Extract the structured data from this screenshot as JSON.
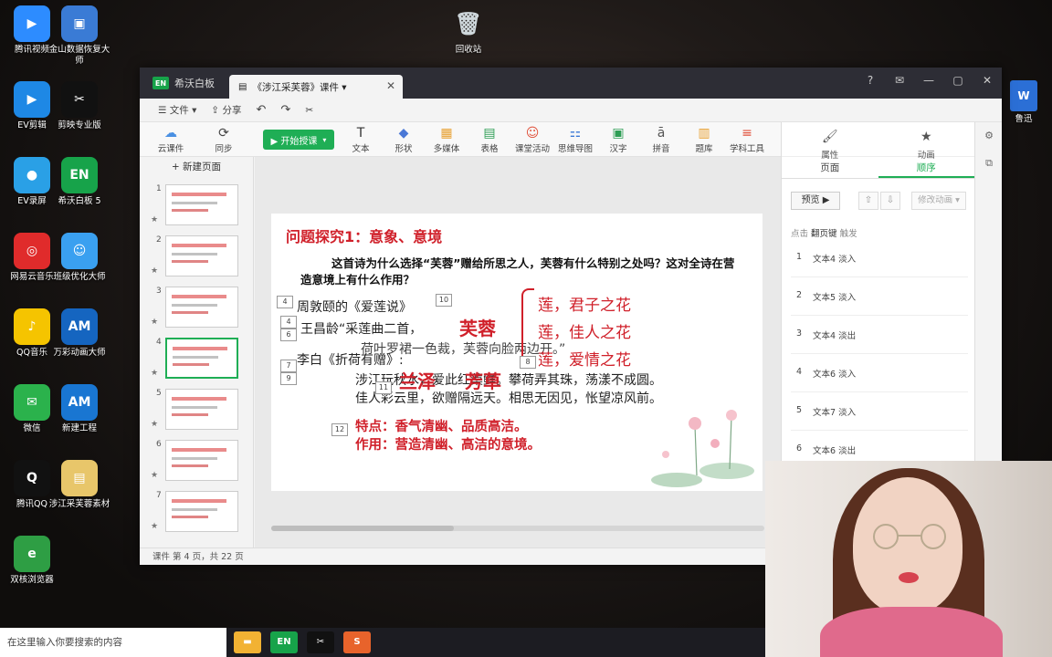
{
  "desktop": {
    "icons_left": [
      {
        "label": "腾讯视频",
        "color": "#2d8cff",
        "glyph": "▶"
      },
      {
        "label": "金山数据恢复大师",
        "color": "#3a7bd5",
        "glyph": "▣"
      },
      {
        "label": "EV剪辑",
        "color": "#1e88e5",
        "glyph": "▶"
      },
      {
        "label": "剪映专业版",
        "color": "#111111",
        "glyph": "✂"
      },
      {
        "label": "EV录屏",
        "color": "#2aa0e6",
        "glyph": "●"
      },
      {
        "label": "希沃白板 5",
        "color": "#17a34a",
        "glyph": "EN"
      },
      {
        "label": "网易云音乐",
        "color": "#e02b2b",
        "glyph": "◎"
      },
      {
        "label": "班级优化大师",
        "color": "#3aa0f0",
        "glyph": "☺"
      },
      {
        "label": "QQ音乐",
        "color": "#f5c400",
        "glyph": "♪"
      },
      {
        "label": "万彩动画大师",
        "color": "#1565c0",
        "glyph": "AM"
      },
      {
        "label": "微信",
        "color": "#2bb24c",
        "glyph": "✉"
      },
      {
        "label": "新建工程",
        "color": "#1976d2",
        "glyph": "AM"
      },
      {
        "label": "腾讯QQ",
        "color": "#111111",
        "glyph": "Q"
      },
      {
        "label": "涉江采芙蓉素材",
        "color": "#e8c66a",
        "glyph": "▤"
      },
      {
        "label": "双核浏览器",
        "color": "#2e9e44",
        "glyph": "e"
      }
    ],
    "recycle_bin": "回收站",
    "right_icon": "鲁迅"
  },
  "app": {
    "app_name": "希沃白板",
    "logo": "EN",
    "doc_tab": "《涉江采芙蓉》课件 ▾",
    "menu": {
      "file": "☰ 文件 ▾",
      "share": "⇪ 分享",
      "undo": "↶",
      "redo": "↷",
      "cut": "✂"
    },
    "toolbar": {
      "cloud": "云课件",
      "sync": "同步",
      "start": "▶ 开始授课",
      "items": [
        "文本",
        "形状",
        "多媒体",
        "表格",
        "课堂活动",
        "思维导图",
        "汉字",
        "拼音",
        "题库",
        "学科工具"
      ]
    },
    "new_page": "+ 新建页面",
    "thumb_numbers": [
      "1",
      "2",
      "3",
      "4",
      "5",
      "6",
      "7"
    ],
    "status": "课件 第 4 页，共 22 页"
  },
  "slide": {
    "title": "问题探究1：意象、意境",
    "question": "这首诗为什么选择“芙蓉”赠给所思之人，芙蓉有什么特别之处吗？这对全诗在营造意境上有什么作用？",
    "line1": "周敦颐的《爱莲说》",
    "line2": "王昌龄“采莲曲二首，",
    "line2b": "荷叶罗裙一色裁，芙蓉向脸两边开。”",
    "line3": "李白《折荷有赠》:",
    "line4": "涉江玩秋水，爱此红蕖鲜。攀荷弄其珠，荡漾不成圆。",
    "line5": "佳人彩云里，欲赠隔远天。相思无因见，怅望凉风前。",
    "furong": "芙蓉",
    "lan_ze": "兰泽",
    "fang_cao": "芳草",
    "lotus_lines": [
      "莲，君子之花",
      "莲，佳人之花",
      "莲，爱情之花"
    ],
    "feature": "特点：香气清幽、品质高洁。",
    "effect": "作用：营造清幽、高洁的意境。",
    "tags": [
      "4",
      "10",
      "4",
      "6",
      "7",
      "9",
      "11",
      "12",
      "8"
    ]
  },
  "right_panel": {
    "attr": "属性",
    "anim": "动画",
    "tab_page": "页面",
    "tab_order": "顺序",
    "preview": "预览 ▶",
    "up": "⇧",
    "down": "⇩",
    "modify": "修改动画 ▾",
    "hint_prefix": "点击",
    "hint_key": "翻页键",
    "hint_suffix": "触发",
    "animations": [
      {
        "n": "1",
        "text": "文本4 淡入"
      },
      {
        "n": "2",
        "text": "文本5 淡入"
      },
      {
        "n": "3",
        "text": "文本4 淡出"
      },
      {
        "n": "4",
        "text": "文本6 淡入"
      },
      {
        "n": "5",
        "text": "文本7 淡入"
      },
      {
        "n": "6",
        "text": "文本6 淡出"
      }
    ]
  },
  "taskbar": {
    "search_placeholder": "在这里输入你要搜索的内容",
    "apps": [
      {
        "name": "file-explorer",
        "color": "#f2b233",
        "glyph": "▬"
      },
      {
        "name": "seewo",
        "color": "#17a34a",
        "glyph": "EN"
      },
      {
        "name": "capcut",
        "color": "#111111",
        "glyph": "✂"
      },
      {
        "name": "sogou",
        "color": "#e8632b",
        "glyph": "S"
      }
    ]
  }
}
